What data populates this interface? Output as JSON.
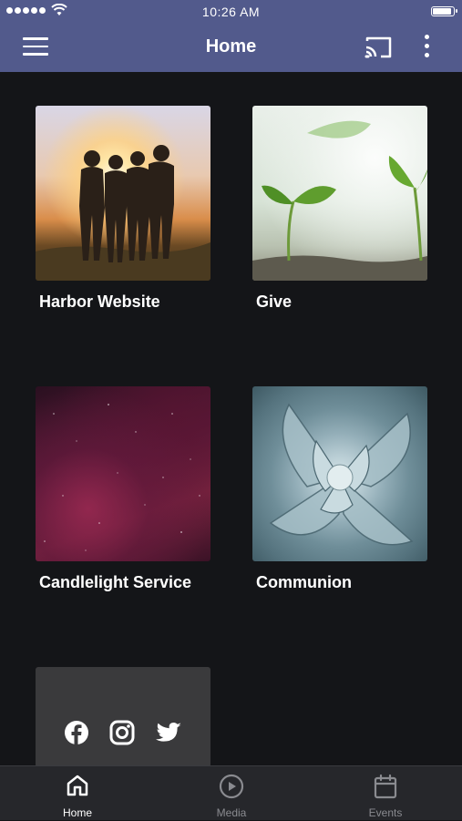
{
  "status_bar": {
    "time": "10:26 AM"
  },
  "header": {
    "title": "Home"
  },
  "tiles": [
    {
      "label": "Harbor Website",
      "image": "people-at-sunset"
    },
    {
      "label": "Give",
      "image": "seedlings"
    },
    {
      "label": "Candlelight Service",
      "image": "starry-night-sky"
    },
    {
      "label": "Communion",
      "image": "succulent-plant"
    }
  ],
  "social": {
    "icons": [
      "facebook-icon",
      "instagram-icon",
      "twitter-icon"
    ]
  },
  "tabbar": {
    "tabs": [
      {
        "label": "Home",
        "icon": "home-icon",
        "active": true
      },
      {
        "label": "Media",
        "icon": "play-icon",
        "active": false
      },
      {
        "label": "Events",
        "icon": "calendar-icon",
        "active": false
      }
    ]
  },
  "colors": {
    "header_bg": "#525a8c",
    "page_bg": "#141518",
    "tabbar_bg": "#26272b",
    "active_tab": "#ffffff",
    "inactive_tab": "#8a8b90"
  }
}
